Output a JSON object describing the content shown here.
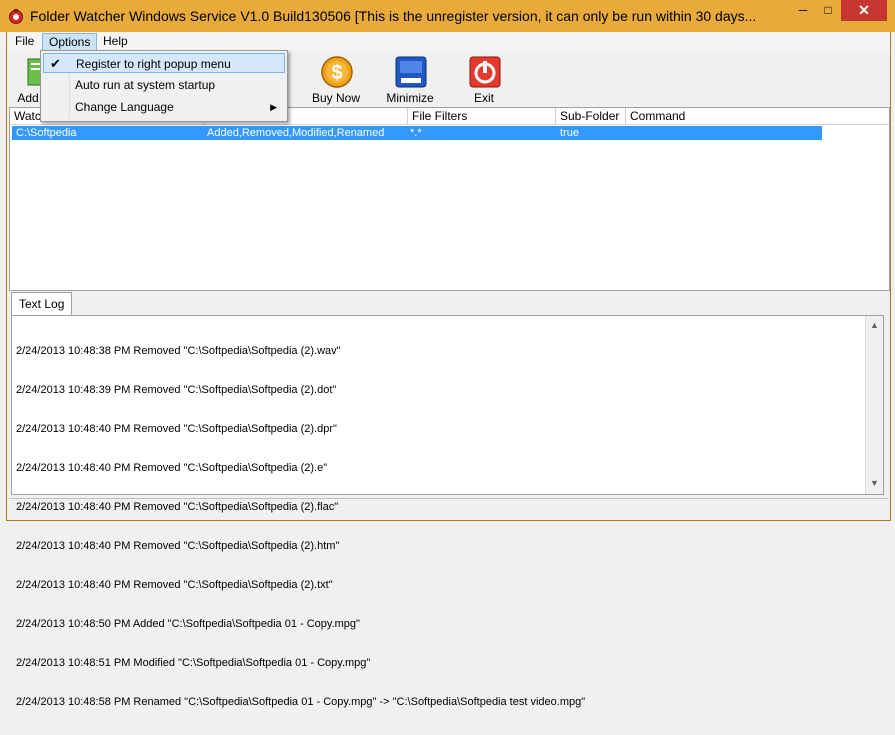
{
  "window": {
    "title": "Folder Watcher Windows Service V1.0 Build130506 [This is the unregister version, it can only be run within 30 days...",
    "min_glyph": "─",
    "max_glyph": "□",
    "close_glyph": "✕"
  },
  "menu": {
    "file": "File",
    "options": "Options",
    "help": "Help"
  },
  "options_menu": {
    "items": [
      {
        "label": "Register to right popup menu",
        "checked": true
      },
      {
        "label": "Auto run at system startup",
        "checked": false
      },
      {
        "label": "Change Language",
        "checked": false,
        "has_submenu": true
      }
    ],
    "check_glyph": "✔",
    "submenu_glyph": "▶"
  },
  "toolbar": {
    "add_label": "Add",
    "buynow_label": "Buy Now",
    "minimize_label": "Minimize",
    "exit_label": "Exit"
  },
  "list": {
    "columns": [
      "Watc",
      "",
      "File Filters",
      "Sub-Folder",
      "Command"
    ],
    "rows": [
      {
        "folder": "C:\\Softpedia",
        "events": "Added,Removed,Modified,Renamed",
        "filters": "*.*",
        "subfolder": "true",
        "command": ""
      }
    ]
  },
  "tabs": {
    "text_log": "Text Log"
  },
  "log": {
    "lines": [
      "2/24/2013 10:48:38 PM Removed \"C:\\Softpedia\\Softpedia (2).wav\"",
      "2/24/2013 10:48:39 PM Removed \"C:\\Softpedia\\Softpedia (2).dot\"",
      "2/24/2013 10:48:40 PM Removed \"C:\\Softpedia\\Softpedia (2).dpr\"",
      "2/24/2013 10:48:40 PM Removed \"C:\\Softpedia\\Softpedia (2).e\"",
      "2/24/2013 10:48:40 PM Removed \"C:\\Softpedia\\Softpedia (2).flac\"",
      "2/24/2013 10:48:40 PM Removed \"C:\\Softpedia\\Softpedia (2).htm\"",
      "2/24/2013 10:48:40 PM Removed \"C:\\Softpedia\\Softpedia (2).txt\"",
      "2/24/2013 10:48:50 PM Added \"C:\\Softpedia\\Softpedia 01 - Copy.mpg\"",
      "2/24/2013 10:48:51 PM Modified \"C:\\Softpedia\\Softpedia 01 - Copy.mpg\"",
      "2/24/2013 10:48:58 PM Renamed \"C:\\Softpedia\\Softpedia 01 - Copy.mpg\" -> \"C:\\Softpedia\\Softpedia test video.mpg\""
    ],
    "scroll_up_glyph": "▲",
    "scroll_down_glyph": "▼"
  },
  "colors": {
    "titlebar": "#e8ab3a",
    "selection": "#3399ff",
    "close": "#c7372f"
  }
}
